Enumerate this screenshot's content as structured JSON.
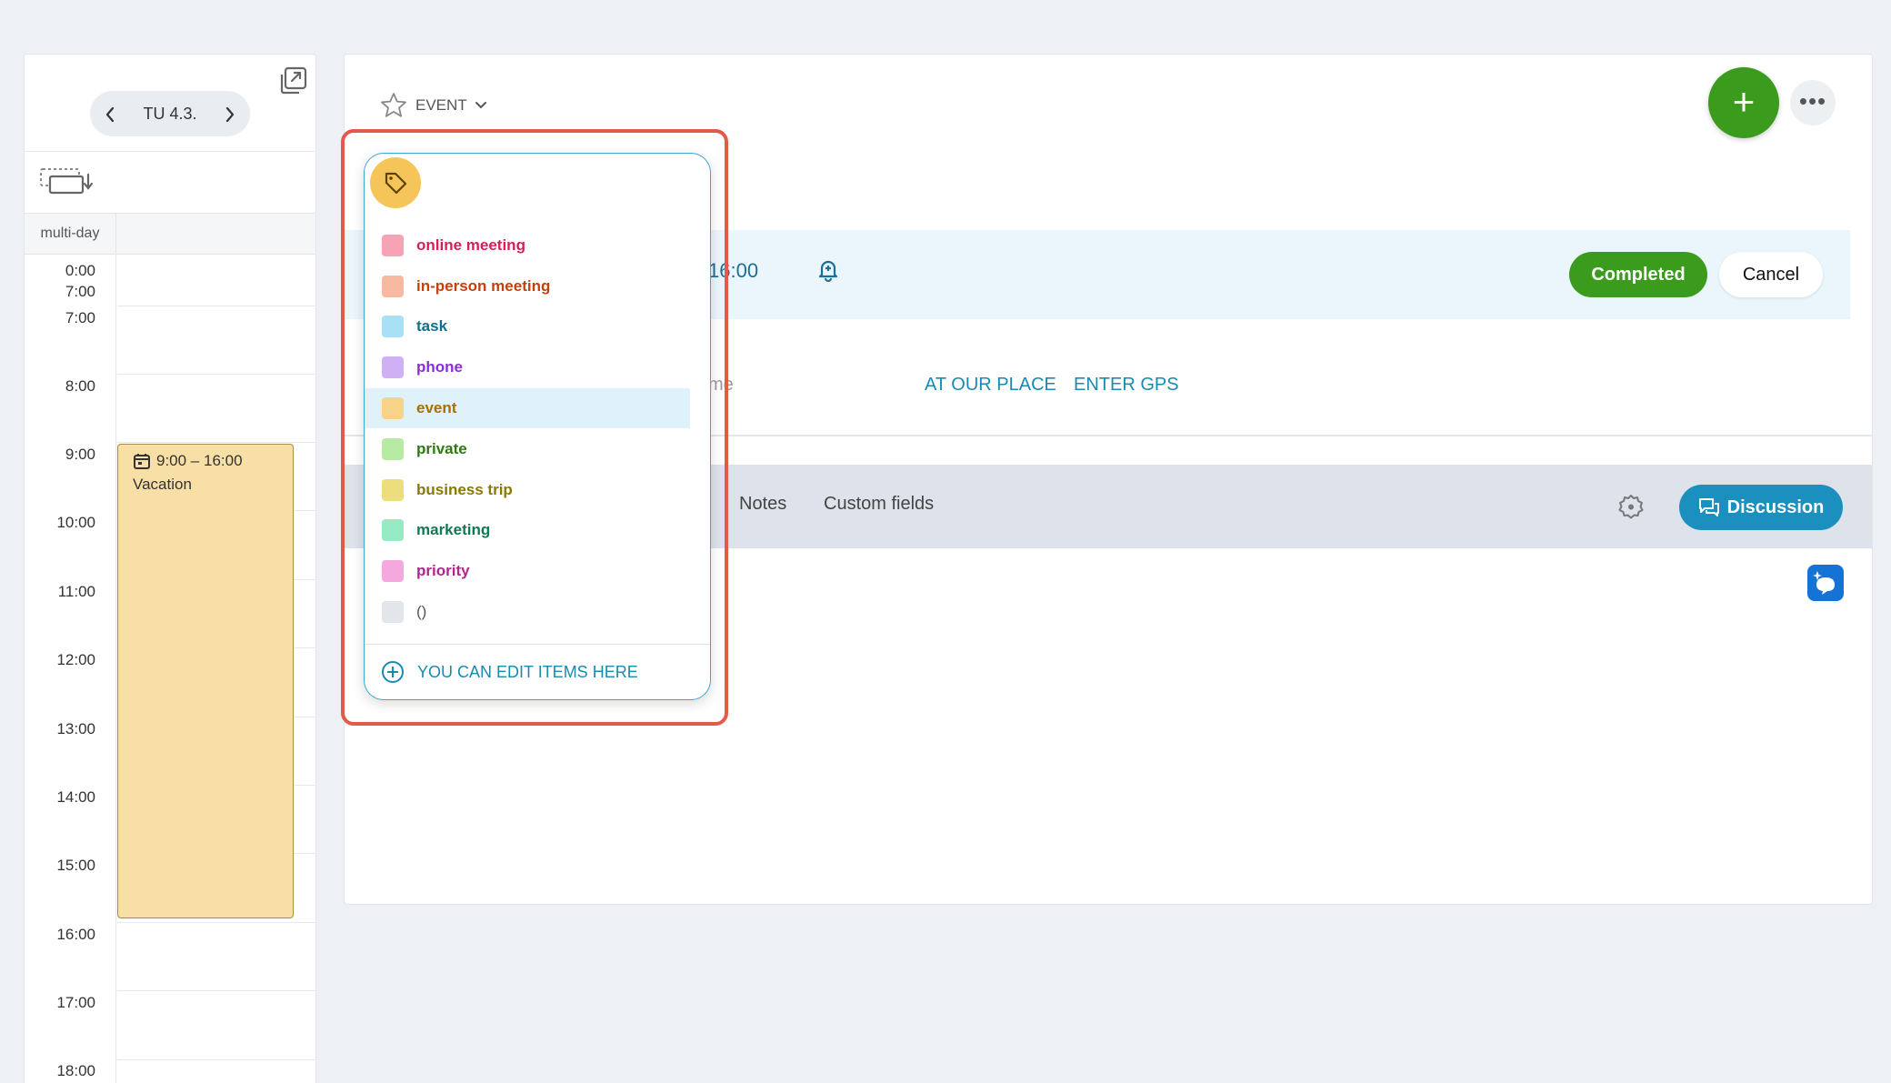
{
  "calendar": {
    "date_label": "TU 4.3.",
    "prev_icon": "chevron-left-icon",
    "next_icon": "chevron-right-icon",
    "multiday_label": "multi-day",
    "allday_range": [
      "0:00",
      "7:00"
    ],
    "hours": [
      "7:00",
      "8:00",
      "9:00",
      "10:00",
      "11:00",
      "12:00",
      "13:00",
      "14:00",
      "15:00",
      "16:00",
      "17:00",
      "18:00"
    ],
    "event": {
      "time": "9:00 – 16:00",
      "title": "Vacation",
      "color": "#f7dfa6"
    }
  },
  "detail": {
    "type_label": "EVENT",
    "time_end": "16:00",
    "completed_label": "Completed",
    "cancel_label": "Cancel",
    "location_fragment": "me",
    "at_our_place": "AT OUR PLACE",
    "enter_gps": "ENTER GPS",
    "tabs": {
      "notes": "Notes",
      "custom_fields": "Custom fields"
    },
    "discussion_label": "Discussion",
    "add_label": "+",
    "accent_green": "#3b9b1d",
    "accent_blue": "#1b8fbd"
  },
  "dropdown": {
    "options": [
      {
        "label": "online meeting",
        "swatch": "#f5a3b5",
        "text": "#d61f56"
      },
      {
        "label": "in-person meeting",
        "swatch": "#f8b9a1",
        "text": "#c2410c"
      },
      {
        "label": "task",
        "swatch": "#a8e0f5",
        "text": "#0e6f91"
      },
      {
        "label": "phone",
        "swatch": "#cfb0f5",
        "text": "#8a2ed6"
      },
      {
        "label": "event",
        "swatch": "#f7d389",
        "text": "#a86f00",
        "selected": true
      },
      {
        "label": "private",
        "swatch": "#b7eaa2",
        "text": "#2f7a12"
      },
      {
        "label": "business trip",
        "swatch": "#ecde7c",
        "text": "#8a7a00"
      },
      {
        "label": "marketing",
        "swatch": "#95eac4",
        "text": "#0f7a52"
      },
      {
        "label": "priority",
        "swatch": "#f5a8de",
        "text": "#b0268f"
      },
      {
        "label": "()",
        "swatch": "#e2e5ea",
        "text": "#555555"
      }
    ],
    "edit_label": "YOU CAN EDIT ITEMS HERE"
  }
}
